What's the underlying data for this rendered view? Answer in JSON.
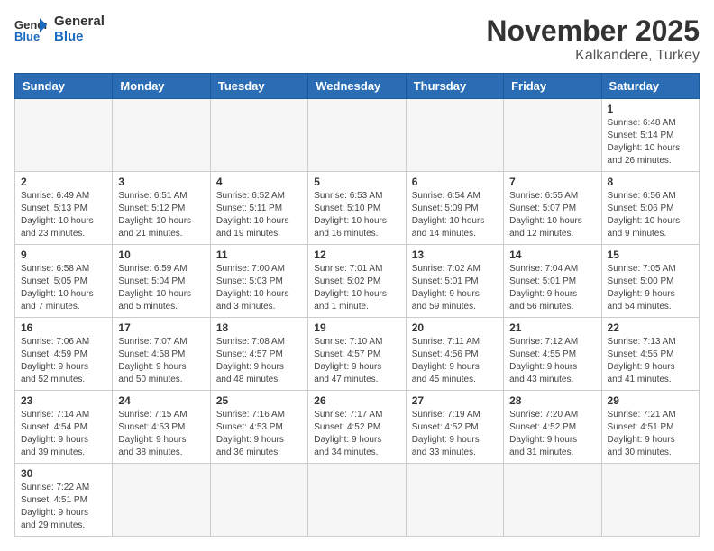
{
  "header": {
    "logo_general": "General",
    "logo_blue": "Blue",
    "month_title": "November 2025",
    "location": "Kalkandere, Turkey"
  },
  "days_of_week": [
    "Sunday",
    "Monday",
    "Tuesday",
    "Wednesday",
    "Thursday",
    "Friday",
    "Saturday"
  ],
  "weeks": [
    [
      {
        "day": "",
        "info": ""
      },
      {
        "day": "",
        "info": ""
      },
      {
        "day": "",
        "info": ""
      },
      {
        "day": "",
        "info": ""
      },
      {
        "day": "",
        "info": ""
      },
      {
        "day": "",
        "info": ""
      },
      {
        "day": "1",
        "info": "Sunrise: 6:48 AM\nSunset: 5:14 PM\nDaylight: 10 hours\nand 26 minutes."
      }
    ],
    [
      {
        "day": "2",
        "info": "Sunrise: 6:49 AM\nSunset: 5:13 PM\nDaylight: 10 hours\nand 23 minutes."
      },
      {
        "day": "3",
        "info": "Sunrise: 6:51 AM\nSunset: 5:12 PM\nDaylight: 10 hours\nand 21 minutes."
      },
      {
        "day": "4",
        "info": "Sunrise: 6:52 AM\nSunset: 5:11 PM\nDaylight: 10 hours\nand 19 minutes."
      },
      {
        "day": "5",
        "info": "Sunrise: 6:53 AM\nSunset: 5:10 PM\nDaylight: 10 hours\nand 16 minutes."
      },
      {
        "day": "6",
        "info": "Sunrise: 6:54 AM\nSunset: 5:09 PM\nDaylight: 10 hours\nand 14 minutes."
      },
      {
        "day": "7",
        "info": "Sunrise: 6:55 AM\nSunset: 5:07 PM\nDaylight: 10 hours\nand 12 minutes."
      },
      {
        "day": "8",
        "info": "Sunrise: 6:56 AM\nSunset: 5:06 PM\nDaylight: 10 hours\nand 9 minutes."
      }
    ],
    [
      {
        "day": "9",
        "info": "Sunrise: 6:58 AM\nSunset: 5:05 PM\nDaylight: 10 hours\nand 7 minutes."
      },
      {
        "day": "10",
        "info": "Sunrise: 6:59 AM\nSunset: 5:04 PM\nDaylight: 10 hours\nand 5 minutes."
      },
      {
        "day": "11",
        "info": "Sunrise: 7:00 AM\nSunset: 5:03 PM\nDaylight: 10 hours\nand 3 minutes."
      },
      {
        "day": "12",
        "info": "Sunrise: 7:01 AM\nSunset: 5:02 PM\nDaylight: 10 hours\nand 1 minute."
      },
      {
        "day": "13",
        "info": "Sunrise: 7:02 AM\nSunset: 5:01 PM\nDaylight: 9 hours\nand 59 minutes."
      },
      {
        "day": "14",
        "info": "Sunrise: 7:04 AM\nSunset: 5:01 PM\nDaylight: 9 hours\nand 56 minutes."
      },
      {
        "day": "15",
        "info": "Sunrise: 7:05 AM\nSunset: 5:00 PM\nDaylight: 9 hours\nand 54 minutes."
      }
    ],
    [
      {
        "day": "16",
        "info": "Sunrise: 7:06 AM\nSunset: 4:59 PM\nDaylight: 9 hours\nand 52 minutes."
      },
      {
        "day": "17",
        "info": "Sunrise: 7:07 AM\nSunset: 4:58 PM\nDaylight: 9 hours\nand 50 minutes."
      },
      {
        "day": "18",
        "info": "Sunrise: 7:08 AM\nSunset: 4:57 PM\nDaylight: 9 hours\nand 48 minutes."
      },
      {
        "day": "19",
        "info": "Sunrise: 7:10 AM\nSunset: 4:57 PM\nDaylight: 9 hours\nand 47 minutes."
      },
      {
        "day": "20",
        "info": "Sunrise: 7:11 AM\nSunset: 4:56 PM\nDaylight: 9 hours\nand 45 minutes."
      },
      {
        "day": "21",
        "info": "Sunrise: 7:12 AM\nSunset: 4:55 PM\nDaylight: 9 hours\nand 43 minutes."
      },
      {
        "day": "22",
        "info": "Sunrise: 7:13 AM\nSunset: 4:55 PM\nDaylight: 9 hours\nand 41 minutes."
      }
    ],
    [
      {
        "day": "23",
        "info": "Sunrise: 7:14 AM\nSunset: 4:54 PM\nDaylight: 9 hours\nand 39 minutes."
      },
      {
        "day": "24",
        "info": "Sunrise: 7:15 AM\nSunset: 4:53 PM\nDaylight: 9 hours\nand 38 minutes."
      },
      {
        "day": "25",
        "info": "Sunrise: 7:16 AM\nSunset: 4:53 PM\nDaylight: 9 hours\nand 36 minutes."
      },
      {
        "day": "26",
        "info": "Sunrise: 7:17 AM\nSunset: 4:52 PM\nDaylight: 9 hours\nand 34 minutes."
      },
      {
        "day": "27",
        "info": "Sunrise: 7:19 AM\nSunset: 4:52 PM\nDaylight: 9 hours\nand 33 minutes."
      },
      {
        "day": "28",
        "info": "Sunrise: 7:20 AM\nSunset: 4:52 PM\nDaylight: 9 hours\nand 31 minutes."
      },
      {
        "day": "29",
        "info": "Sunrise: 7:21 AM\nSunset: 4:51 PM\nDaylight: 9 hours\nand 30 minutes."
      }
    ],
    [
      {
        "day": "30",
        "info": "Sunrise: 7:22 AM\nSunset: 4:51 PM\nDaylight: 9 hours\nand 29 minutes."
      },
      {
        "day": "",
        "info": ""
      },
      {
        "day": "",
        "info": ""
      },
      {
        "day": "",
        "info": ""
      },
      {
        "day": "",
        "info": ""
      },
      {
        "day": "",
        "info": ""
      },
      {
        "day": "",
        "info": ""
      }
    ]
  ]
}
